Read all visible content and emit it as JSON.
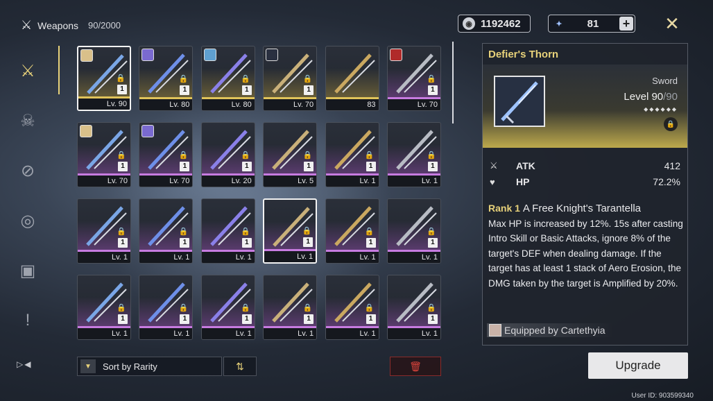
{
  "header": {
    "title": "Weapons",
    "count": "90/2000"
  },
  "currency": [
    {
      "icon": "shell-credit-icon",
      "value": "1192462"
    },
    {
      "icon": "astrite-icon",
      "value": "81"
    }
  ],
  "rail": [
    "weapon-tab",
    "echo-tab",
    "material-tab",
    "development-tab",
    "resource-tab",
    "quest-item-tab"
  ],
  "grid": {
    "items": [
      {
        "level": "Lv. 90",
        "rank": "1",
        "rarity": "5",
        "locked": true,
        "selected": true,
        "avatar": true
      },
      {
        "level": "Lv. 80",
        "rank": "1",
        "rarity": "5",
        "locked": true,
        "avatar": true
      },
      {
        "level": "Lv. 80",
        "rank": "1",
        "rarity": "5",
        "locked": true,
        "avatar": true
      },
      {
        "level": "Lv. 70",
        "rank": "1",
        "rarity": "5",
        "locked": true,
        "avatar": true
      },
      {
        "level": "83",
        "rank": "",
        "rarity": "5",
        "locked": false
      },
      {
        "level": "Lv. 70",
        "rank": "1",
        "rarity": "4",
        "locked": true,
        "avatar": true
      },
      {
        "level": "Lv. 70",
        "rank": "1",
        "rarity": "4",
        "locked": true,
        "avatar": true
      },
      {
        "level": "Lv. 70",
        "rank": "1",
        "rarity": "4",
        "locked": true,
        "avatar": true
      },
      {
        "level": "Lv. 20",
        "rank": "1",
        "rarity": "4",
        "locked": true
      },
      {
        "level": "Lv. 5",
        "rank": "1",
        "rarity": "4",
        "locked": true
      },
      {
        "level": "Lv. 1",
        "rank": "1",
        "rarity": "4",
        "locked": true
      },
      {
        "level": "Lv. 1",
        "rank": "1",
        "rarity": "4",
        "locked": true
      },
      {
        "level": "Lv. 1",
        "rank": "1",
        "rarity": "4",
        "locked": true
      },
      {
        "level": "Lv. 1",
        "rank": "1",
        "rarity": "4",
        "locked": true
      },
      {
        "level": "Lv. 1",
        "rank": "1",
        "rarity": "4",
        "locked": true
      },
      {
        "level": "Lv. 1",
        "rank": "1",
        "rarity": "4",
        "locked": true,
        "highlight": true
      },
      {
        "level": "Lv. 1",
        "rank": "1",
        "rarity": "4",
        "locked": true
      },
      {
        "level": "Lv. 1",
        "rank": "1",
        "rarity": "4",
        "locked": true
      },
      {
        "level": "Lv. 1",
        "rank": "1",
        "rarity": "4",
        "locked": true
      },
      {
        "level": "Lv. 1",
        "rank": "1",
        "rarity": "4",
        "locked": true
      },
      {
        "level": "Lv. 1",
        "rank": "1",
        "rarity": "4",
        "locked": true
      },
      {
        "level": "Lv. 1",
        "rank": "1",
        "rarity": "4",
        "locked": true
      },
      {
        "level": "Lv. 1",
        "rank": "1",
        "rarity": "4",
        "locked": true
      },
      {
        "level": "Lv. 1",
        "rank": "1",
        "rarity": "4",
        "locked": true
      }
    ]
  },
  "sort": {
    "label": "Sort by Rarity"
  },
  "detail": {
    "name": "Defier's Thorn",
    "type": "Sword",
    "level_current": "Level 90",
    "level_max": "/90",
    "stars": "◆◆◆◆◆◆",
    "stats": [
      {
        "icon": "atk-icon",
        "label": "ATK",
        "value": "412"
      },
      {
        "icon": "hp-icon",
        "label": "HP",
        "value": "72.2%"
      }
    ],
    "rank_label": "Rank 1",
    "skill_name": "A Free Knight's Tarantella",
    "skill_desc": "Max HP is increased by 12%. 15s after casting Intro Skill or Basic Attacks, ignore 8% of the target's DEF when dealing damage. If the target has at least 1 stack of Aero Erosion, the DMG taken by the target is Amplified by 20%.",
    "equipped": "Equipped by Cartethyia"
  },
  "upgrade_label": "Upgrade",
  "user_id": "User ID: 903599340",
  "colors": {
    "accent": "#e8d27a",
    "rarity5": "#e0c35a",
    "rarity4": "#c77be0"
  }
}
